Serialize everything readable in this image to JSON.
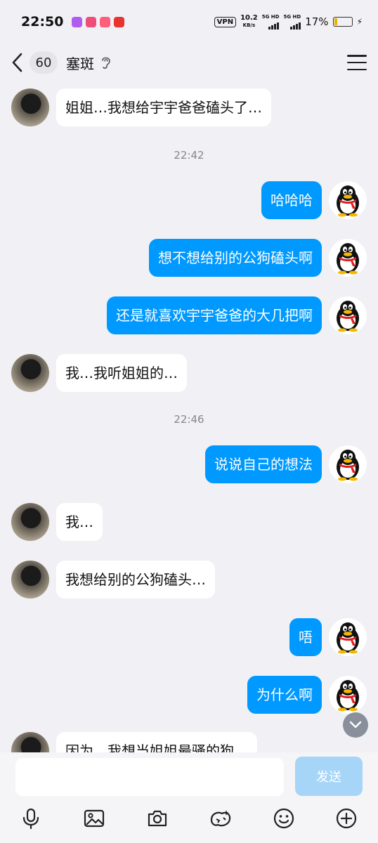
{
  "status_bar": {
    "time": "22:50",
    "vpn": "VPN",
    "speed_value": "10.2",
    "speed_unit": "KB/s",
    "sim1_label": "5G HD",
    "sim2_label": "5G HD",
    "battery": "17%",
    "battery_level": 0.17,
    "app_icon_colors": [
      "#b05cf0",
      "#f04e7a",
      "#ff5d7a",
      "#e8332e"
    ]
  },
  "header": {
    "unread_count": "60",
    "title": "塞斑",
    "icons": [
      "back-icon",
      "ear-icon",
      "menu-icon"
    ]
  },
  "colors": {
    "outgoing_bubble": "#0099ff",
    "incoming_bubble": "#ffffff",
    "background": "#f0f0f5",
    "send_button": "#a6d5f8"
  },
  "messages": [
    {
      "side": "left",
      "text": "姐姐…我想给宇宇爸爸磕头了…"
    },
    {
      "type": "time",
      "text": "22:42"
    },
    {
      "side": "right",
      "text": "哈哈哈"
    },
    {
      "side": "right",
      "text": "想不想给别的公狗磕头啊"
    },
    {
      "side": "right",
      "text": "还是就喜欢宇宇爸爸的大几把啊"
    },
    {
      "side": "left",
      "text": "我…我听姐姐的…"
    },
    {
      "type": "time",
      "text": "22:46"
    },
    {
      "side": "right",
      "text": "说说自己的想法"
    },
    {
      "side": "left",
      "text": "我…"
    },
    {
      "side": "left",
      "text": "我想给别的公狗磕头…"
    },
    {
      "side": "right",
      "text": "唔"
    },
    {
      "side": "right",
      "text": "为什么啊"
    },
    {
      "side": "left",
      "text": "因为…我想当姐姐最骚的狗…"
    }
  ],
  "input": {
    "placeholder": "",
    "send_label": "发送"
  },
  "toolbar_icons": [
    "microphone-icon",
    "image-icon",
    "camera-icon",
    "red-packet-icon",
    "emoji-icon",
    "plus-icon"
  ]
}
